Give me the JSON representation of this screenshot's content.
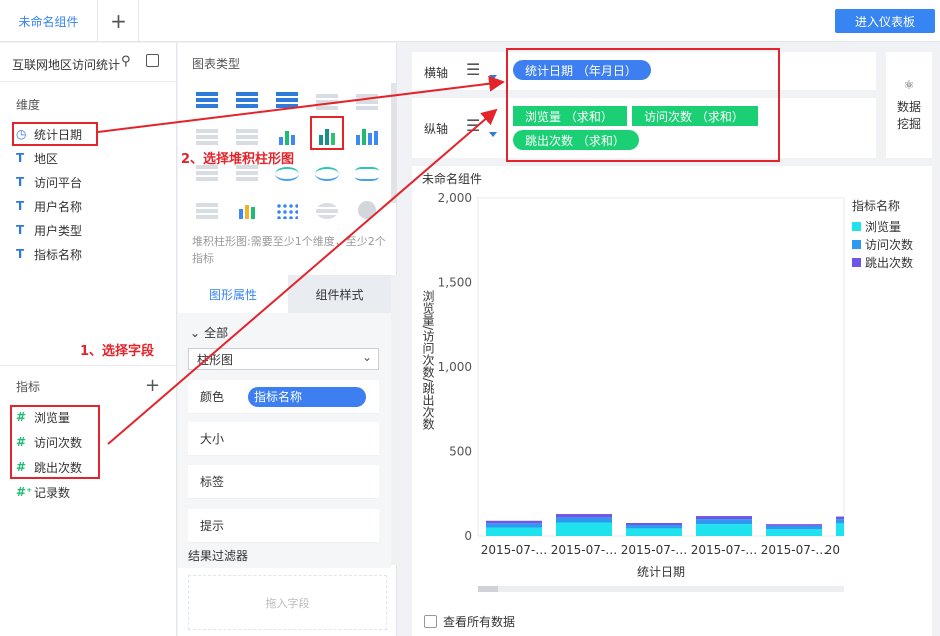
{
  "topbar": {
    "active_tab": "未命名组件",
    "add_tab": "+",
    "enter_dashboard": "进入仪表板"
  },
  "left": {
    "dataset_title": "互联网地区访问统计",
    "dimension_label": "维度",
    "dimensions": [
      {
        "icon": "clock-icon",
        "label": "统计日期"
      },
      {
        "icon": "text-type-icon",
        "label": "地区"
      },
      {
        "icon": "text-type-icon",
        "label": "访问平台"
      },
      {
        "icon": "text-type-icon",
        "label": "用户名称"
      },
      {
        "icon": "text-type-icon",
        "label": "用户类型"
      },
      {
        "icon": "text-type-icon",
        "label": "指标名称"
      }
    ],
    "metric_label": "指标",
    "metrics": [
      {
        "icon": "number-type-icon",
        "label": "浏览量"
      },
      {
        "icon": "number-type-icon",
        "label": "访问次数"
      },
      {
        "icon": "number-type-icon",
        "label": "跳出次数"
      },
      {
        "icon": "record-count-icon",
        "label": "记录数"
      }
    ]
  },
  "middle": {
    "chart_type_title": "图表类型",
    "hint": "堆积柱形图:需要至少1个维度，至少2个指标",
    "tab_graph_props": "图形属性",
    "tab_component_style": "组件样式",
    "all_label": "全部",
    "chart_select_value": "柱形图",
    "props": {
      "color": "颜色",
      "color_value": "指标名称",
      "size": "大小",
      "label": "标签",
      "tooltip": "提示"
    },
    "filter_title": "结果过滤器",
    "drop_placeholder": "拖入字段"
  },
  "axes": {
    "x_label": "横轴",
    "x_field": "统计日期 （年月日）",
    "y_label": "纵轴",
    "y_fields": [
      "浏览量 （求和）",
      "访问次数 （求和）",
      "跳出次数 （求和）"
    ]
  },
  "mining": {
    "label": "数据\n挖掘"
  },
  "chart": {
    "name": "未命名组件",
    "show_all": "查看所有数据",
    "legend_title": "指标名称",
    "colors": {
      "浏览量": "#1ee3ee",
      "访问次数": "#2d9af0",
      "跳出次数": "#7055e8"
    }
  },
  "annotations": {
    "step1": "1、选择字段",
    "step2": "2、选择堆积柱形图"
  },
  "chart_data": {
    "type": "bar",
    "stacked": true,
    "categories": [
      "2015-07-…",
      "2015-07-…",
      "2015-07-…",
      "2015-07-…",
      "2015-07-…",
      "20"
    ],
    "series": [
      {
        "name": "浏览量",
        "values": [
          50,
          80,
          45,
          70,
          40,
          75
        ]
      },
      {
        "name": "访问次数",
        "values": [
          25,
          30,
          20,
          30,
          20,
          25
        ]
      },
      {
        "name": "跳出次数",
        "values": [
          15,
          20,
          12,
          18,
          10,
          15
        ]
      }
    ],
    "ylim": [
      0,
      2000
    ],
    "yticks": [
      "0",
      "500",
      "1,000",
      "1,500",
      "2,000"
    ],
    "xlabel": "统计日期",
    "ylabel": "浏览量/访问次数/跳出次数",
    "legend": "right"
  }
}
